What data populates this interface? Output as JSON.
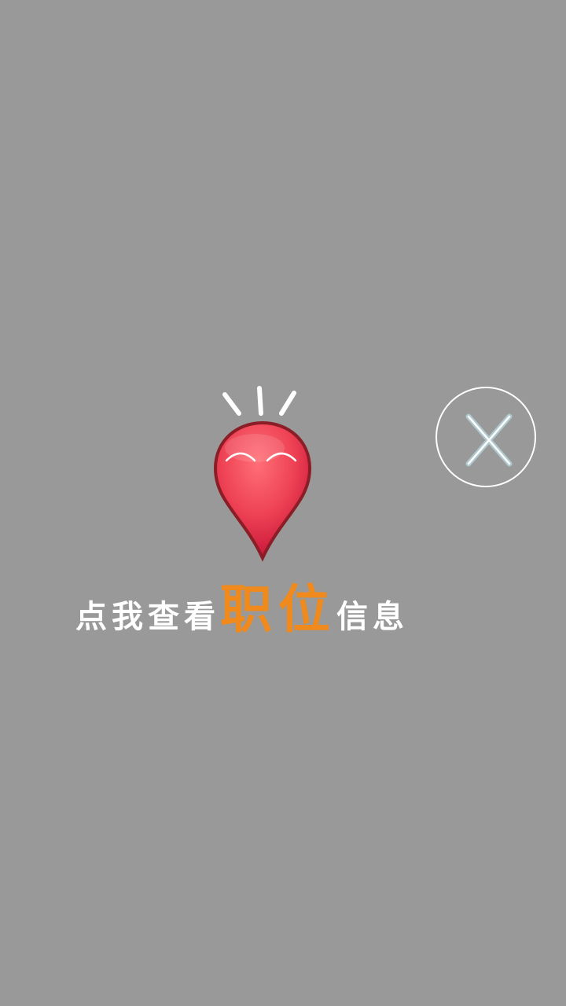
{
  "prompt": {
    "text_before": "点我查看",
    "text_highlight": "职位",
    "text_after": "信息"
  },
  "colors": {
    "background": "#999999",
    "highlight": "#f08a1c",
    "pin": "#e8394d",
    "text": "#ffffff"
  },
  "icons": {
    "pin": "smiling-location-pin-icon",
    "close": "close-icon"
  }
}
